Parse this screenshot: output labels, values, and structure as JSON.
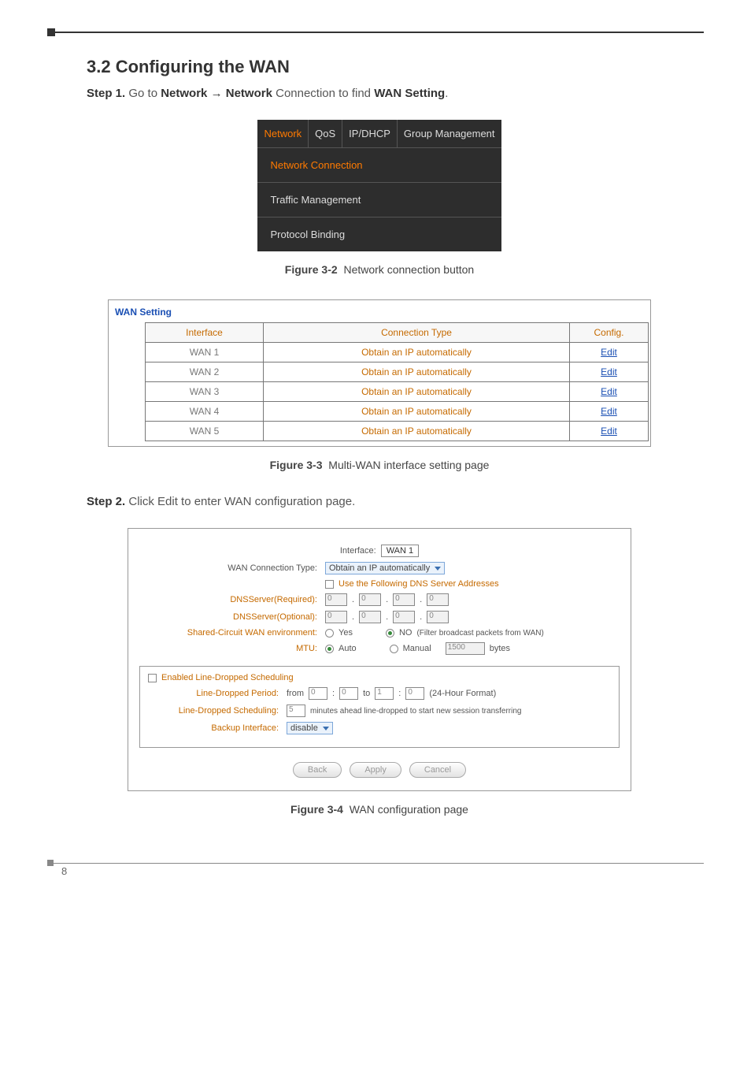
{
  "section": {
    "title": "3.2 Configuring the WAN"
  },
  "step1": {
    "label": "Step 1.",
    "prefix": "Go to ",
    "nav1": "Network",
    "arrow": "→",
    "nav2": "Network",
    "mid": " Connection to find ",
    "target": "WAN Setting",
    "suffix": "."
  },
  "nav": {
    "tabs": {
      "network": "Network",
      "qos": "QoS",
      "ipdhcp": "IP/DHCP",
      "group": "Group Management"
    },
    "subs": {
      "connection": "Network Connection",
      "traffic": "Traffic Management",
      "protocol": "Protocol Binding"
    }
  },
  "fig32": {
    "label": "Figure 3-2",
    "text": "Network connection button"
  },
  "wanSetting": {
    "title": "WAN Setting",
    "headers": {
      "iface": "Interface",
      "conn": "Connection Type",
      "cfg": "Config."
    },
    "rows": [
      {
        "iface": "WAN 1",
        "conn": "Obtain an IP automatically",
        "cfg": "Edit"
      },
      {
        "iface": "WAN 2",
        "conn": "Obtain an IP automatically",
        "cfg": "Edit"
      },
      {
        "iface": "WAN 3",
        "conn": "Obtain an IP automatically",
        "cfg": "Edit"
      },
      {
        "iface": "WAN 4",
        "conn": "Obtain an IP automatically",
        "cfg": "Edit"
      },
      {
        "iface": "WAN 5",
        "conn": "Obtain an IP automatically",
        "cfg": "Edit"
      }
    ]
  },
  "fig33": {
    "label": "Figure 3-3",
    "text": "Multi-WAN interface setting page"
  },
  "step2": {
    "label": "Step 2.",
    "text": "Click Edit to enter WAN configuration page."
  },
  "form": {
    "interfaceLabel": "Interface:",
    "interfaceValue": "WAN 1",
    "connTypeLabel": "WAN Connection Type:",
    "connTypeValue": "Obtain an IP automatically",
    "useDnsLabel": "Use the Following DNS Server Addresses",
    "dnsReqLabel": "DNSServer(Required):",
    "dnsOptLabel": "DNSServer(Optional):",
    "ipOctet": "0",
    "sharedLabel": "Shared-Circuit WAN environment:",
    "yes": "Yes",
    "no": "NO",
    "filterNote": "(Filter broadcast packets from WAN)",
    "mtuLabel": "MTU:",
    "mtuAuto": "Auto",
    "mtuManual": "Manual",
    "mtuValue": "1500",
    "bytes": "bytes",
    "schedTitle": "Enabled Line-Dropped Scheduling",
    "periodLabel": "Line-Dropped Period:",
    "from": "from",
    "to": "to",
    "h0": "0",
    "m0": "0",
    "h1": "1",
    "m1": "0",
    "hourFmt": "(24-Hour Format)",
    "schedLabel": "Line-Dropped Scheduling:",
    "schedVal": "5",
    "schedNote": "minutes ahead line-dropped to start new session transferring",
    "backupLabel": "Backup Interface:",
    "backupValue": "disable",
    "btnBack": "Back",
    "btnApply": "Apply",
    "btnCancel": "Cancel"
  },
  "fig34": {
    "label": "Figure 3-4",
    "text": "WAN configuration page"
  },
  "pageNumber": "8"
}
